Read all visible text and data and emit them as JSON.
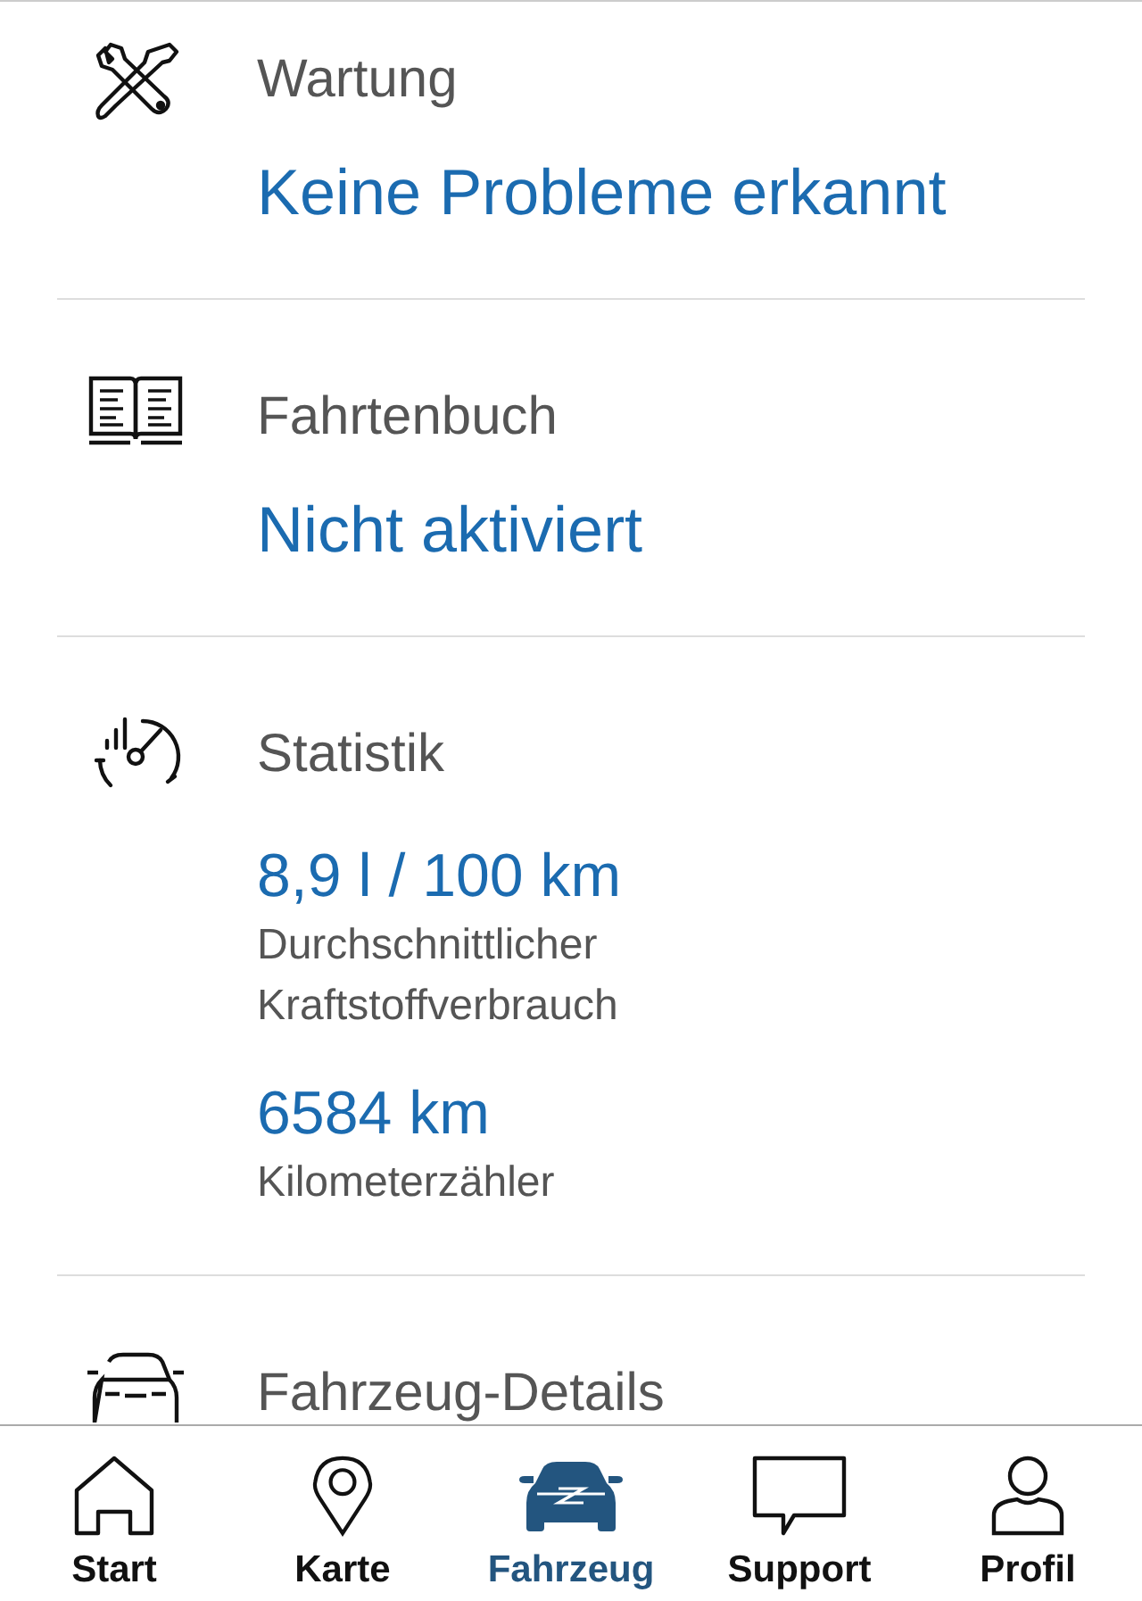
{
  "sections": [
    {
      "title": "Wartung",
      "value": "Keine Probleme erkannt"
    },
    {
      "title": "Fahrtenbuch",
      "value": "Nicht aktiviert"
    },
    {
      "title": "Statistik",
      "stats": [
        {
          "value": "8,9 l / 100 km",
          "label": "Durchschnittlicher Kraftstoffverbrauch"
        },
        {
          "value": "6584 km",
          "label": "Kilometerzähler"
        }
      ]
    },
    {
      "title": "Fahrzeug-Details"
    }
  ],
  "tabs": [
    {
      "label": "Start",
      "selected": false
    },
    {
      "label": "Karte",
      "selected": false
    },
    {
      "label": "Fahrzeug",
      "selected": true
    },
    {
      "label": "Support",
      "selected": false
    },
    {
      "label": "Profil",
      "selected": false
    }
  ]
}
